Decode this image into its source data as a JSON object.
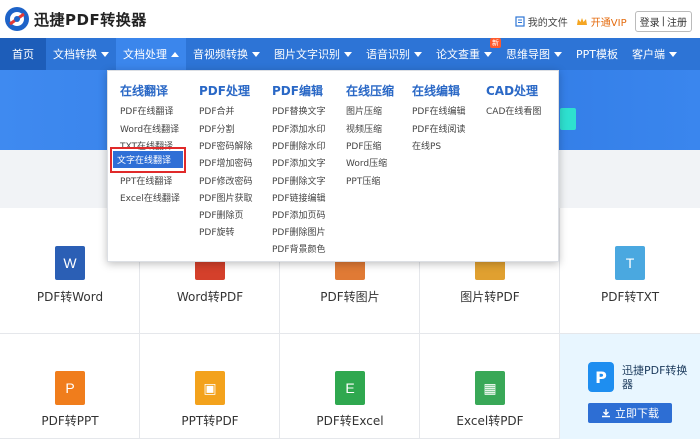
{
  "brand": "迅捷PDF转换器",
  "top_links": {
    "my_files": "我的文件",
    "vip": "开通VIP",
    "login": "登录",
    "register": "注册",
    "sep": "|"
  },
  "nav": [
    {
      "label": "首页",
      "caret": ""
    },
    {
      "label": "文档转换",
      "caret": "down"
    },
    {
      "label": "文档处理",
      "caret": "up"
    },
    {
      "label": "音视频转换",
      "caret": "down"
    },
    {
      "label": "图片文字识别",
      "caret": "down"
    },
    {
      "label": "语音识别",
      "caret": "down"
    },
    {
      "label": "论文查重",
      "caret": "down",
      "badge": "新"
    },
    {
      "label": "思维导图",
      "caret": "down"
    },
    {
      "label": "PPT模板",
      "caret": ""
    },
    {
      "label": "客户端",
      "caret": "down"
    }
  ],
  "dropdown": {
    "columns": [
      {
        "title": "在线翻译",
        "items": [
          "PDF在线翻译",
          "Word在线翻译",
          "TXT在线翻译",
          "文字在线翻译",
          "PPT在线翻译",
          "Excel在线翻译"
        ]
      },
      {
        "title": "PDF处理",
        "items": [
          "PDF合并",
          "PDF分割",
          "PDF密码解除",
          "PDF增加密码",
          "PDF修改密码",
          "PDF图片获取",
          "PDF删除页",
          "PDF旋转"
        ]
      },
      {
        "title": "PDF编辑",
        "items": [
          "PDF替换文字",
          "PDF添加水印",
          "PDF删除水印",
          "PDF添加文字",
          "PDF删除文字",
          "PDF链接编辑",
          "PDF添加页码",
          "PDF删除图片",
          "PDF背景颜色"
        ]
      },
      {
        "title": "在线压缩",
        "items": [
          "图片压缩",
          "视频压缩",
          "PDF压缩",
          "Word压缩",
          "PPT压缩"
        ]
      },
      {
        "title": "在线编辑",
        "items": [
          "PDF在线编辑",
          "PDF在线阅读",
          "在线PS"
        ]
      },
      {
        "title": "CAD处理",
        "items": [
          "CAD在线看图"
        ]
      }
    ],
    "selected": "文字在线翻译"
  },
  "tools_row1": [
    {
      "label": "PDF转Word",
      "icon": "W",
      "color": "#2b5fb5"
    },
    {
      "label": "Word转PDF",
      "icon": "",
      "color": "#d4402b"
    },
    {
      "label": "PDF转图片",
      "icon": "",
      "color": "#e07a35"
    },
    {
      "label": "图片转PDF",
      "icon": "",
      "color": "#e0a030"
    },
    {
      "label": "PDF转TXT",
      "icon": "T",
      "color": "#4aa8e0"
    }
  ],
  "tools_row2": [
    {
      "label": "PDF转PPT",
      "icon": "P",
      "color": "#f07d1c"
    },
    {
      "label": "PPT转PDF",
      "icon": "▣",
      "color": "#f3a21c"
    },
    {
      "label": "PDF转Excel",
      "icon": "E",
      "color": "#2fa84f"
    },
    {
      "label": "Excel转PDF",
      "icon": "▦",
      "color": "#39a857"
    }
  ],
  "promo": {
    "title": "迅捷PDF转换器",
    "button": "立即下载",
    "icon": "P"
  }
}
